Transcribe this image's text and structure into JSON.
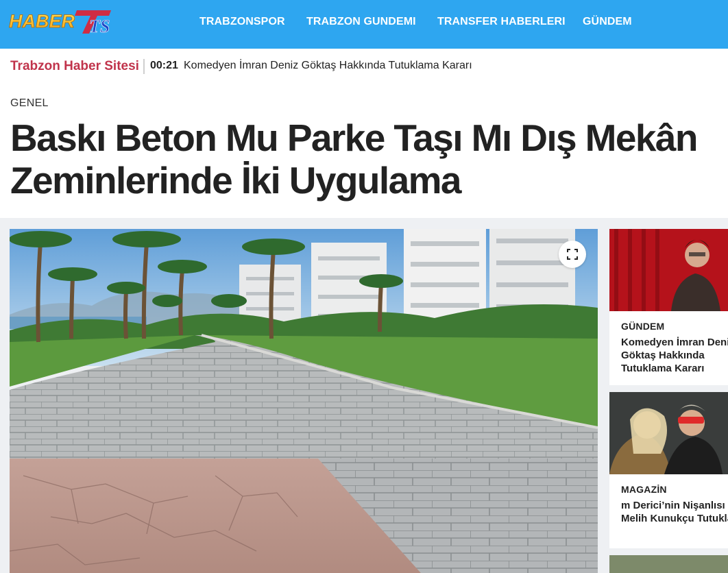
{
  "header": {
    "logo_text_1": "HABER",
    "logo_text_2": "TS",
    "nav": [
      {
        "label": "TRABZONSPOR"
      },
      {
        "label": "TRABZON GUNDEMI"
      },
      {
        "label": "TRANSFER HABERLERI"
      },
      {
        "label": "GÜNDEM"
      }
    ],
    "brand_color": "#2ea6f0"
  },
  "ticker": {
    "site_name": "Trabzon Haber Sitesi",
    "time": "00:21",
    "headline": "Komedyen İmran Deniz Göktaş Hakkında Tutuklama Kararı"
  },
  "article": {
    "category": "GENEL",
    "title": "Baskı Beton Mu Parke Taşı Mı Dış Mekân Zeminlerinde İki Uygulama",
    "hero_icon": "expand-icon"
  },
  "sidebar": {
    "cards": [
      {
        "category": "GÜNDEM",
        "title": "Komedyen İmran Deniz Göktaş Hakkında Tutuklama Kararı"
      },
      {
        "category": "MAGAZİN",
        "title": "m Derici’nin Nişanlısı Melih Kunukçu Tutuklandı"
      }
    ]
  }
}
